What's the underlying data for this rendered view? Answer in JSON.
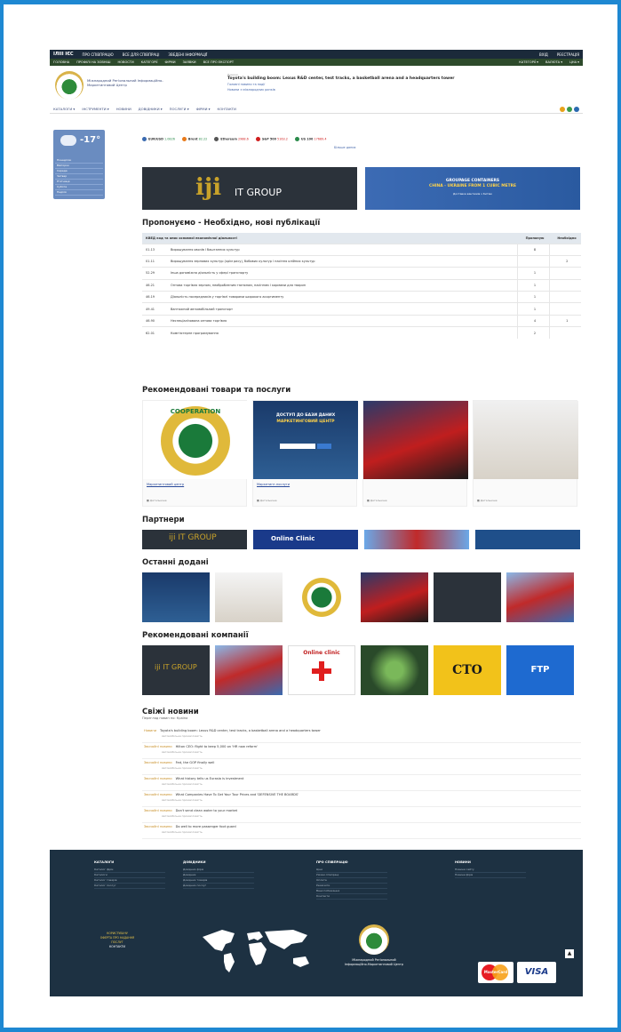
{
  "topbar": {
    "logo": "ІЛІІІ ІЄС",
    "links": [
      "ПРО СПІВПРАЦЮ",
      "ВСЕ ДЛЯ СПІВПРАЦІ",
      "ЗВЕДЕНІ ІНФОРМАЦІЇ"
    ],
    "right": [
      "ВХІД",
      "РЕЄСТРАЦІЯ"
    ]
  },
  "menubar": {
    "items": [
      "ГОЛОВНА",
      "ПРОФІЛІ НА ЗОВНІШ",
      "НОВОСТИ",
      "КАТЕГОРІЇ",
      "ФІРМИ",
      "ЗАЯВКИ",
      "ВСЕ ПРО ЕКСПОРТ"
    ],
    "right": [
      "КАТЕГОРІЇ ▾",
      "ВАЛЮТА ▾",
      "ЦНА ▾"
    ]
  },
  "header": {
    "org_name": "Міжнародний Регіональний Інформаційно-Маркетинговий Центр",
    "news_label": "Новини",
    "news_title": "Toyota's building boom: Lexus R&D center, test tracks, a basketball arena and a headquarters tower",
    "news_sub1": "Головні новини та події",
    "news_sub2": "Новини з міжнародних ринків"
  },
  "nav": {
    "items": [
      "КАТАЛОГИ ▾",
      "ІНСТРУМЕНТИ ▾",
      "НОВИНИ",
      "ДОВІДНИКИ ▾",
      "ПОСЛУГИ ▾",
      "ФІРМИ ▾",
      "КОНТАКТИ"
    ]
  },
  "weather": {
    "temp": "-17°",
    "rows": [
      "Понеділок",
      "Вівторок",
      "Середа",
      "Четвер",
      "П'ятниця",
      "Субота",
      "Неділя"
    ]
  },
  "ticker": {
    "items": [
      {
        "label": "EUR/USD",
        "value": "1.0826",
        "color": "#3a6ab0"
      },
      {
        "label": "Brent",
        "value": "82.22",
        "color": "#e87a1a"
      },
      {
        "label": "Ethereum",
        "value": "2988.6",
        "color": "#555555"
      },
      {
        "label": "S&P 500",
        "value": "5163.2",
        "color": "#d01e1e"
      },
      {
        "label": "US 100",
        "value": "17689.4",
        "color": "#2a8a4a"
      }
    ],
    "link": "Більше даних"
  },
  "banners": {
    "left": {
      "brand": "iji",
      "text": "IT GROUP"
    },
    "right": {
      "line1": "GROUPAGE CONTAINERS",
      "line2": "CHINA - UKRAINE FROM 1 CUBIC METRE",
      "line3": "Доставка вантажів з Китаю"
    }
  },
  "sections": {
    "publications": "Пропонуємо - Необхідно, нові публікації",
    "products": "Рекомендовані товари та послуги",
    "partners": "Партнери",
    "latest": "Останні додані",
    "companies": "Рекомендовані компанії",
    "news": "Свіжі новини"
  },
  "publications_table": {
    "headers": [
      "КВЕД код та опис основної економічної діяльності",
      "Пропоную",
      "Необхідно"
    ],
    "rows": [
      {
        "code": "01.13",
        "desc": "Вирощування овочів і баштанних культур",
        "offer": "8",
        "need": ""
      },
      {
        "code": "01.11",
        "desc": "Вирощування зернових культур (крім рису), бобових культур і насіння олійних культур",
        "offer": "",
        "need": "2"
      },
      {
        "code": "52.29",
        "desc": "Інша допоміжна діяльність у сфері транспорту",
        "offer": "1",
        "need": ""
      },
      {
        "code": "46.21",
        "desc": "Оптова торгівля зерном, необробленим тютюном, насінням і кормами для тварин",
        "offer": "1",
        "need": ""
      },
      {
        "code": "46.19",
        "desc": "Діяльність посередників у торгівлі товарами широкого асортименту",
        "offer": "1",
        "need": ""
      },
      {
        "code": "49.41",
        "desc": "Вантажний автомобільний транспорт",
        "offer": "1",
        "need": ""
      },
      {
        "code": "46.90",
        "desc": "Неспеціалізована оптова торгівля",
        "offer": "4",
        "need": "1"
      },
      {
        "code": "62.01",
        "desc": "Комп'ютерне програмування",
        "offer": "2",
        "need": ""
      }
    ]
  },
  "products": [
    {
      "caption": "Маркетинговий центр",
      "foot": "■ Детальніше"
    },
    {
      "caption": "Маркетинг-послуги",
      "foot": "■ Детальніше"
    },
    {
      "caption": "",
      "foot": "■ Детальніше"
    },
    {
      "caption": "",
      "foot": "■ Детальніше"
    }
  ],
  "product_banner": {
    "title": "ДОСТУП ДО БАЗИ ДАНИХ",
    "subtitle": "МАРКЕТИНГОВИЙ ЦЕНТР",
    "coop": "COOPERATION"
  },
  "partners": [
    "iji IT GROUP",
    "Online Clinic",
    "",
    ""
  ],
  "companies": [
    "iji IT GROUP",
    "",
    "Online clinic",
    "",
    "CTO",
    "FTP"
  ],
  "news": {
    "sub": "Перегляд новин по: Країна",
    "items": [
      {
        "date": "Новини",
        "title": "Toyota's building boom: Lexus R&D center, test tracks, a basketball arena and a headquarters tower",
        "meta": "Автомобільна промисловість"
      },
      {
        "date": "Звичайні новини",
        "title": "Hilton CEO: flight to keep 5,000 on 'HR now reform'",
        "meta": "Автомобільна промисловість"
      },
      {
        "date": "Звичайні новини",
        "title": "Fed, the GOP finally well",
        "meta": "Автомобільна промисловість"
      },
      {
        "date": "Звичайні новини",
        "title": "What history tells us Eurasia is investment",
        "meta": "Автомобільна промисловість"
      },
      {
        "date": "Звичайні новини",
        "title": "What Companies Have To Get Your Tour Prices and 'DEFENSIVE THE BOARDS'",
        "meta": "Автомобільна промисловість"
      },
      {
        "date": "Звичайні новини",
        "title": "Don't send clean water to your market",
        "meta": "Автомобільна промисловість"
      },
      {
        "date": "Звичайні новини",
        "title": "Do well to more passenger foot guard",
        "meta": "Автомобільна промисловість"
      }
    ]
  },
  "footer": {
    "cols": [
      {
        "title": "КАТАЛОГИ",
        "items": [
          "Каталог фірм",
          "Каталоги",
          "Каталог товарів",
          "Каталог послуг"
        ]
      },
      {
        "title": "ДОВІДНИКИ",
        "items": [
          "Довідник фірм",
          "Довідник",
          "Довідник товарів",
          "Довідник послуг"
        ]
      },
      {
        "title": "ПРО СПІВПРАЦЮ",
        "items": [
          "Ціни",
          "Умови співпраці",
          "Оплата",
          "Реквізити",
          "Ваші побажання",
          "Контакти"
        ]
      },
      {
        "title": "НОВИНИ",
        "items": [
          "Новини сайту",
          "Новини фірм"
        ]
      }
    ],
    "left_text": [
      "КОРИСТУВАЧУ",
      "ОФЕРТА ПРО НАДАННЯ",
      "ПОСЛУГ",
      "КОНТАКТИ"
    ],
    "org_name": "Міжнародний Регіональний Інформаційно-Маркетинговий Центр",
    "mastercard": "MasterCard",
    "visa": "VISA",
    "up": "▲"
  }
}
